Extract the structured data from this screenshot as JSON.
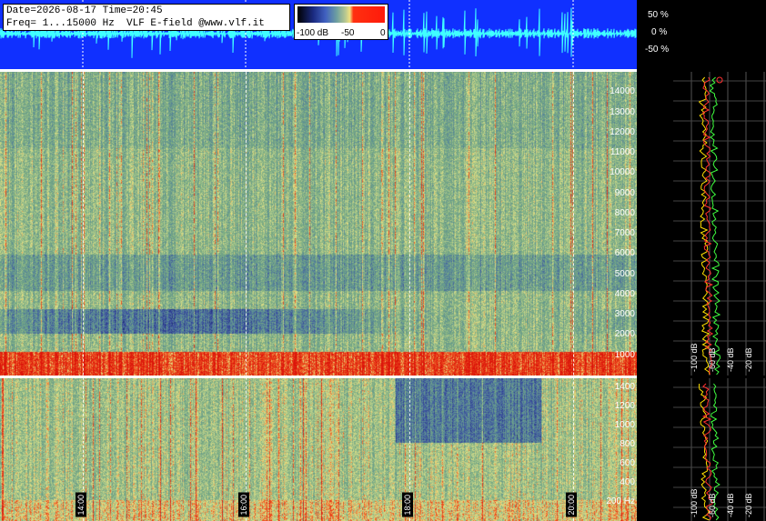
{
  "header": {
    "line1": "Date=2026-08-17 Time=20:45",
    "line2": "Freq= 1...15000 Hz  VLF E-field @www.vlf.it"
  },
  "colorbar": {
    "labels": [
      "-100 dB",
      "-50",
      "0"
    ],
    "colors": [
      "#000000",
      "#1a2a80",
      "#6ea0a0",
      "#f0e080",
      "#ff1a0a"
    ]
  },
  "waveform": {
    "pct_labels": [
      "50 %",
      "0 %",
      "-50 %"
    ],
    "trace_color": "#40ffff",
    "bg_color": "#1030ff"
  },
  "chart_data": [
    {
      "type": "heatmap",
      "panel": "spectrogram-high",
      "ytick_labels": [
        "14000",
        "13000",
        "12000",
        "11000",
        "10000",
        "9000",
        "8000",
        "7000",
        "6000",
        "5000",
        "4000",
        "3000",
        "2000",
        "1000"
      ],
      "ylim": [
        0,
        15000
      ],
      "time_labels": [
        "14:00",
        "16:00",
        "18:00",
        "20:00"
      ],
      "profile_db_labels": [
        "-100 dB",
        "-60 dB",
        "-40 dB",
        "-20 dB"
      ]
    },
    {
      "type": "heatmap",
      "panel": "spectrogram-low",
      "ytick_labels": [
        "1400",
        "1200",
        "1000",
        "800",
        "600",
        "400",
        "200 Hz"
      ],
      "ylim": [
        0,
        1500
      ],
      "time_labels": [
        "14:00",
        "16:00",
        "18:00",
        "20:00"
      ],
      "profile_db_labels": [
        "-100 dB",
        "-60 dB",
        "-40 dB",
        "-20 dB"
      ]
    }
  ]
}
